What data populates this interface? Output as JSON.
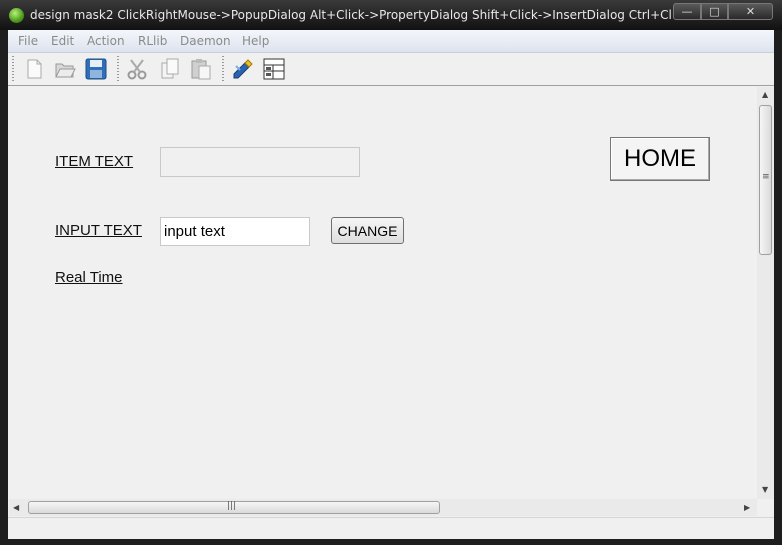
{
  "window": {
    "title": "design mask2   ClickRightMouse->PopupDialog   Alt+Click->PropertyDialog   Shift+Click->InsertDialog   Ctrl+Click-...",
    "min_glyph": "—",
    "max_glyph": "□",
    "close_glyph": "✕"
  },
  "menu": [
    "File",
    "Edit",
    "Action",
    "RLlib",
    "Daemon",
    "Help"
  ],
  "toolbar_icons": [
    "new-file-icon",
    "open-folder-icon",
    "save-disk-icon",
    "cut-scissors-icon",
    "copy-icon",
    "paste-icon",
    "edit-pencil-icon",
    "properties-grid-icon"
  ],
  "form": {
    "item_text_label": "ITEM TEXT",
    "item_text_value": "",
    "input_text_label": "INPUT TEXT",
    "input_text_value": "input text",
    "change_button": "CHANGE",
    "realtime_label": "Real Time",
    "home_button": "HOME"
  },
  "scroll": {
    "grip": "≡",
    "grip_h": "|||",
    "up": "▲",
    "down": "▼",
    "left": "◀",
    "right": "▶"
  }
}
